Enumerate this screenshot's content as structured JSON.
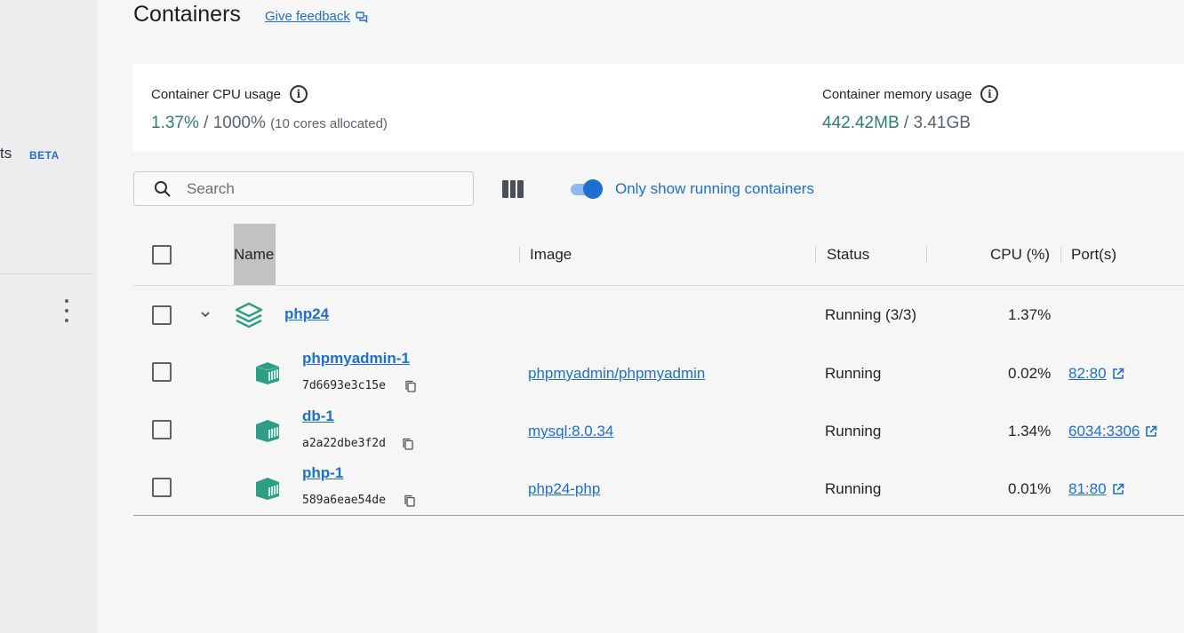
{
  "sidebar": {
    "partial_label": "ts",
    "beta_badge": "BETA"
  },
  "header": {
    "title": "Containers",
    "feedback_link": "Give feedback"
  },
  "stats": {
    "cpu": {
      "label": "Container CPU usage",
      "used": "1.37%",
      "separator": " / ",
      "total": "1000%",
      "note": "(10 cores allocated)"
    },
    "memory": {
      "label": "Container memory usage",
      "used": "442.42MB",
      "separator": " / ",
      "total": "3.41GB"
    }
  },
  "toolbar": {
    "search_placeholder": "Search",
    "toggle_label": "Only show running containers",
    "toggle_on": true
  },
  "table": {
    "columns": {
      "name": "Name",
      "image": "Image",
      "status": "Status",
      "cpu": "CPU (%)",
      "ports": "Port(s)"
    },
    "group": {
      "name": "php24",
      "status": "Running (3/3)",
      "cpu": "1.37%"
    },
    "rows": [
      {
        "name": "phpmyadmin-1",
        "id": "7d6693e3c15e",
        "image": "phpmyadmin/phpmyadmin",
        "status": "Running",
        "cpu": "0.02%",
        "port": "82:80"
      },
      {
        "name": "db-1",
        "id": "a2a22dbe3f2d",
        "image": "mysql:8.0.34",
        "status": "Running",
        "cpu": "1.34%",
        "port": "6034:3306"
      },
      {
        "name": "php-1",
        "id": "589a6eae54de",
        "image": "php24-php",
        "status": "Running",
        "cpu": "0.01%",
        "port": "81:80"
      }
    ]
  },
  "colors": {
    "accent": "#1f6fd1",
    "teal": "#2f9e87",
    "value_green": "#2f7d6d"
  },
  "icons": [
    "feedback-icon",
    "info-icon",
    "search-icon",
    "columns-icon",
    "chevron-down-icon",
    "stack-icon",
    "container-icon",
    "copy-icon",
    "external-link-icon",
    "kebab-menu-icon"
  ]
}
